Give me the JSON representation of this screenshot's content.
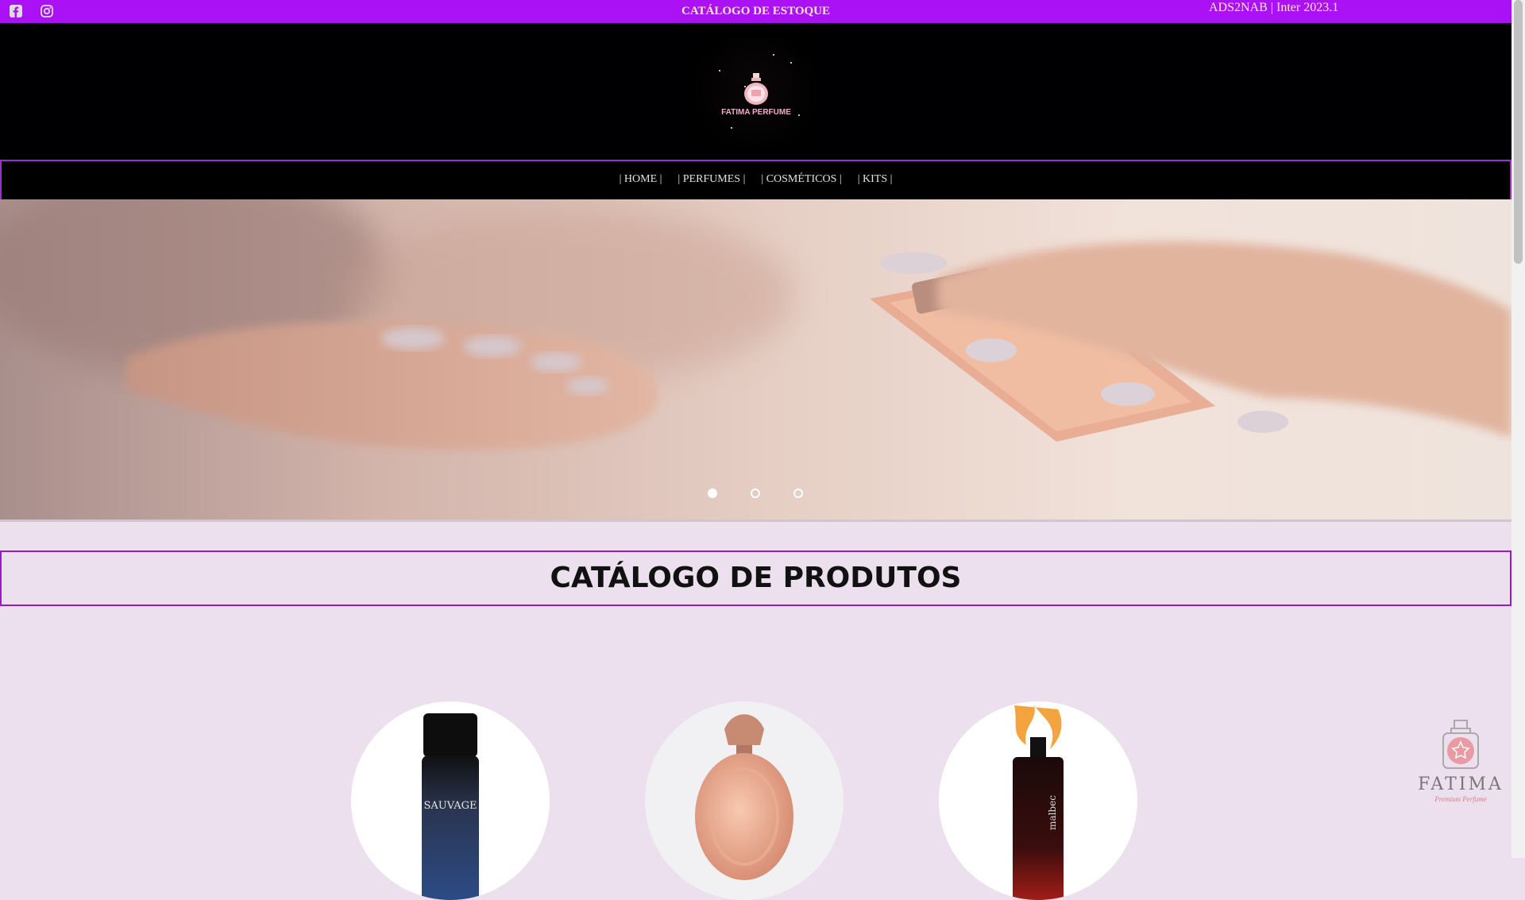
{
  "topbar": {
    "title": "CATÁLOGO DE ESTOQUE",
    "right_text": "ADS2NAB | Inter 2023.1",
    "background": "#aa11f5",
    "icons": [
      "facebook-icon",
      "instagram-icon"
    ]
  },
  "logo": {
    "brand_text": "FATIMA PERFUME"
  },
  "nav": {
    "items": [
      {
        "label": "| HOME |"
      },
      {
        "label": "| PERFUMES |"
      },
      {
        "label": "| COSMÉTICOS |"
      },
      {
        "label": "| KITS |"
      }
    ]
  },
  "carousel": {
    "slides": 3,
    "active_slide": 1
  },
  "catalog": {
    "title": "CATÁLOGO DE PRODUTOS"
  },
  "products": [
    {
      "label": "SAUVAGE"
    },
    {
      "label": ""
    },
    {
      "label": "malbec"
    }
  ],
  "floating_brand": {
    "word": "FATIMA",
    "sub": "Premium Perfume"
  }
}
